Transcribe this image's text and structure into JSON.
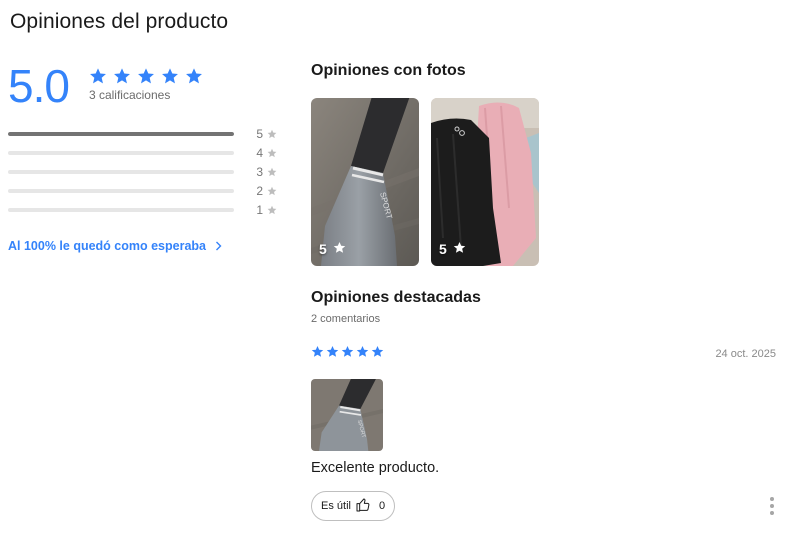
{
  "page": {
    "title": "Opiniones del producto"
  },
  "summary": {
    "rating": "5.0",
    "rating_value": 5,
    "stars_filled": 5,
    "count_text": "3 calificaciones",
    "distribution": [
      {
        "label": "5",
        "fraction": 1.0
      },
      {
        "label": "4",
        "fraction": 0
      },
      {
        "label": "3",
        "fraction": 0
      },
      {
        "label": "2",
        "fraction": 0
      },
      {
        "label": "1",
        "fraction": 0
      }
    ],
    "fit_link": "Al 100% le quedó como esperaba"
  },
  "photos_section": {
    "title": "Opiniones con fotos",
    "photos": [
      {
        "rating": "5",
        "subject": "gray-sock-photo"
      },
      {
        "rating": "5",
        "subject": "black-pink-socks-photo"
      }
    ]
  },
  "featured": {
    "title": "Opiniones destacadas",
    "count": "2 comentarios",
    "reviews": [
      {
        "stars": 5,
        "date": "24 oct. 2025",
        "text": "Excelente producto.",
        "useful_label": "Es útil",
        "useful_count": "0"
      }
    ]
  },
  "colors": {
    "accent": "#3483fa",
    "bar_fill": "#737373",
    "bar_track": "#e6e6e6",
    "muted_star": "#bdbdbd"
  }
}
